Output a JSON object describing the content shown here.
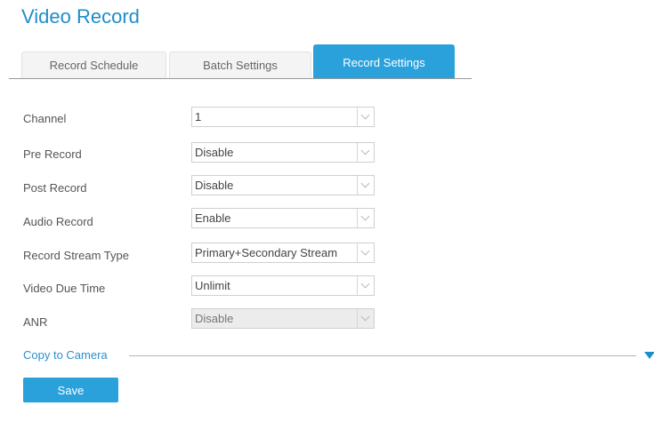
{
  "page": {
    "title": "Video Record"
  },
  "tabs": [
    {
      "label": "Record Schedule"
    },
    {
      "label": "Batch Settings"
    },
    {
      "label": "Record Settings",
      "active": true
    }
  ],
  "fields": [
    {
      "label": "Channel",
      "value": "1",
      "disabled": false
    },
    {
      "label": "Pre Record",
      "value": "Disable",
      "disabled": false
    },
    {
      "label": "Post Record",
      "value": "Disable",
      "disabled": false
    },
    {
      "label": "Audio Record",
      "value": "Enable",
      "disabled": false
    },
    {
      "label": "Record Stream Type",
      "value": "Primary+Secondary Stream",
      "disabled": false
    },
    {
      "label": "Video Due Time",
      "value": "Unlimit",
      "disabled": false
    },
    {
      "label": "ANR",
      "value": "Disable",
      "disabled": true
    }
  ],
  "copy": {
    "label": "Copy to Camera",
    "expand_icon": "triangle-down-icon"
  },
  "actions": {
    "save_label": "Save"
  },
  "colors": {
    "accent": "#2aa1db",
    "title": "#1e8ec9",
    "link": "#2a8fd0"
  }
}
